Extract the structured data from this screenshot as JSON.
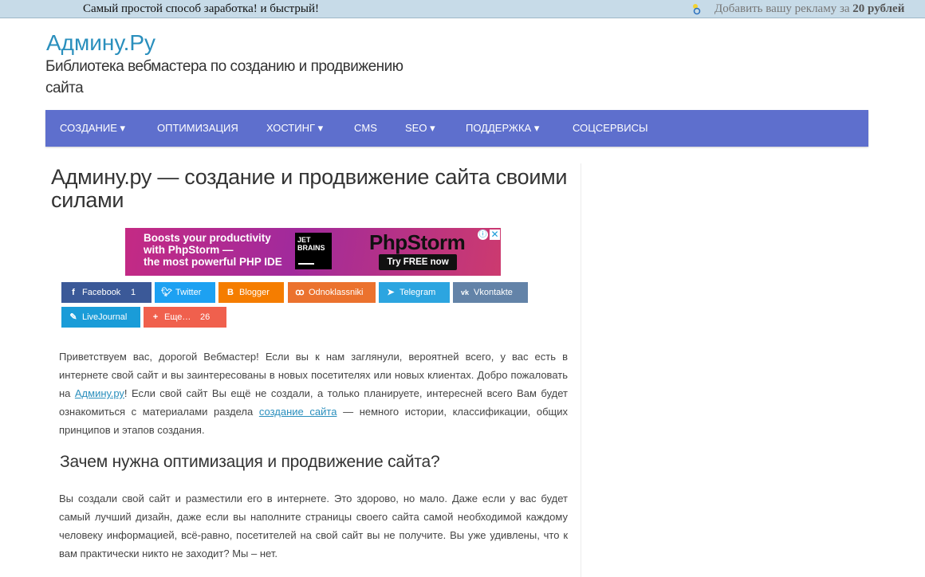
{
  "topbar": {
    "promo_text": "Самый простой способ заработка! и быстрый!",
    "ad_prefix": "Добавить вашу рекламу за ",
    "ad_price": "20 рублей"
  },
  "header": {
    "site_title": "Админу.Ру",
    "site_description": "Библиотека вебмастера по созданию и продвижению сайта"
  },
  "nav": {
    "items": [
      {
        "label": "СОЗДАНИЕ ▾"
      },
      {
        "label": "ОПТИМИЗАЦИЯ"
      },
      {
        "label": "ХОСТИНГ ▾"
      },
      {
        "label": "CMS"
      },
      {
        "label": "SEO ▾"
      },
      {
        "label": "ПОДДЕРЖКА ▾"
      },
      {
        "label": "СОЦСЕРВИСЫ"
      }
    ],
    "color": "#5e6fcd"
  },
  "article": {
    "title": "Админу.ру — создание и продвижение сайта своими силами",
    "banner": {
      "line1": "Boosts your productivity",
      "line2": "with PhpStorm —",
      "line3": "the most powerful PHP IDE",
      "jb_line1": "JET",
      "jb_line2": "BRAINS",
      "product": "PhpStorm",
      "cta": "Try FREE now"
    },
    "share": [
      {
        "label": "Facebook",
        "count": "1",
        "color": "#3b5998",
        "icon": "facebook-icon",
        "glyph": "f"
      },
      {
        "label": "Twitter",
        "count": "",
        "color": "#1da1f2",
        "icon": "twitter-icon",
        "glyph": "t"
      },
      {
        "label": "Blogger",
        "count": "",
        "color": "#f57d00",
        "icon": "blogger-icon",
        "glyph": "B"
      },
      {
        "label": "Odnoklassniki",
        "count": "",
        "color": "#eb722e",
        "icon": "odnoklassniki-icon",
        "glyph": "o"
      },
      {
        "label": "Telegram",
        "count": "",
        "color": "#2ca5e0",
        "icon": "telegram-icon",
        "glyph": "➤"
      },
      {
        "label": "Vkontakte",
        "count": "",
        "color": "#6383a8",
        "icon": "vkontakte-icon",
        "glyph": "vk"
      },
      {
        "label": "LiveJournal",
        "count": "",
        "color": "#1a9cd8",
        "icon": "livejournal-icon",
        "glyph": "✎"
      },
      {
        "label": "Еще…",
        "count": "26",
        "color": "#f0604d",
        "icon": "plus-icon",
        "glyph": "+"
      }
    ],
    "p1_part1": "Приветствуем вас, дорогой Вебмастер! Если вы к нам заглянули, вероятней всего, у вас есть в интернете свой сайт и вы заинтересованы в новых посетителях или новых клиентах. Добро пожаловать на ",
    "p1_link1": "Админу.ру",
    "p1_part2": "! Если свой сайт Вы ещё не создали, а только планируете, интересней всего Вам будет ознакомиться с материалами раздела ",
    "p1_link2": "создание сайта",
    "p1_part3": " — немного истории, классификации, общих принципов и этапов создания.",
    "h2": "Зачем нужна оптимизация и продвижение сайта?",
    "p2": "Вы создали свой сайт и разместили его в интернете. Это здорово, но мало. Даже если у вас будет самый лучший дизайн, даже если вы наполните страницы своего сайта самой необходимой каждому человеку информацией, всё-равно, посетителей на свой сайт вы не получите. Вы уже удивлены, что к вам практически никто не заходит? Мы – нет."
  }
}
